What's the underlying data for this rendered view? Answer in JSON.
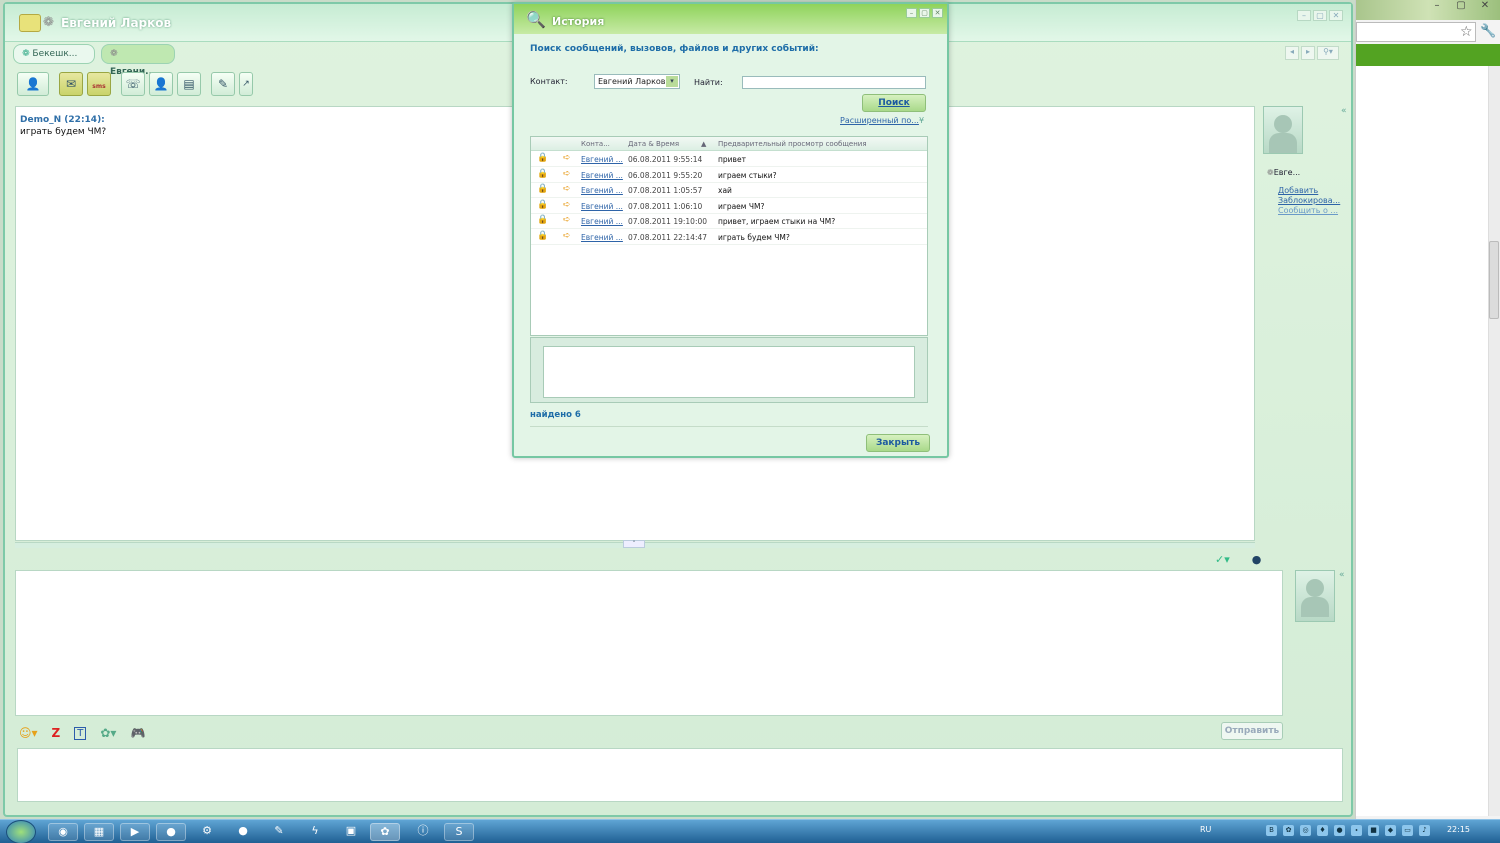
{
  "main": {
    "title": "Евгений Ларков",
    "tabs": [
      {
        "label": "Бекешк..."
      },
      {
        "label": "Евгени..."
      }
    ],
    "chat": {
      "sender": "Demo_N (22:14):",
      "text": "играть будем ЧМ?"
    },
    "contact_panel": {
      "name": "Евге...",
      "links": [
        "Добавить",
        "Заблокирова...",
        "Сообщить о ..."
      ]
    },
    "send_label": "Отправить",
    "sms_label": "sms"
  },
  "history": {
    "title": "История",
    "heading": "Поиск сообщений, вызовов, файлов и других событий:",
    "contact_label": "Контакт:",
    "contact_value": "Евгений Ларков",
    "find_label": "Найти:",
    "find_value": "",
    "search_button": "Поиск",
    "advanced_link": "Расширенный по...",
    "columns": [
      "Конта...",
      "Дата & Время",
      "Предварительный просмотр сообщения"
    ],
    "rows": [
      {
        "contact": "Евгений ...",
        "datetime": "06.08.2011 9:55:14",
        "preview": "привет"
      },
      {
        "contact": "Евгений ...",
        "datetime": "06.08.2011 9:55:20",
        "preview": "играем стыки?"
      },
      {
        "contact": "Евгений ...",
        "datetime": "07.08.2011 1:05:57",
        "preview": "хай"
      },
      {
        "contact": "Евгений ...",
        "datetime": "07.08.2011 1:06:10",
        "preview": "играем ЧМ?"
      },
      {
        "contact": "Евгений ...",
        "datetime": "07.08.2011 19:10:00",
        "preview": "привет, играем стыки на ЧМ?"
      },
      {
        "contact": "Евгений ...",
        "datetime": "07.08.2011 22:14:47",
        "preview": "играть будем ЧМ?"
      }
    ],
    "found": "найдено 6",
    "close_button": "Закрыть"
  },
  "taskbar": {
    "lang": "RU",
    "clock": "22:15"
  },
  "colors": {
    "accent_green": "#8fd35b",
    "link_blue": "#2e64a8",
    "heading_blue": "#1e6da8",
    "taskbar_blue": "#1f5f93"
  }
}
